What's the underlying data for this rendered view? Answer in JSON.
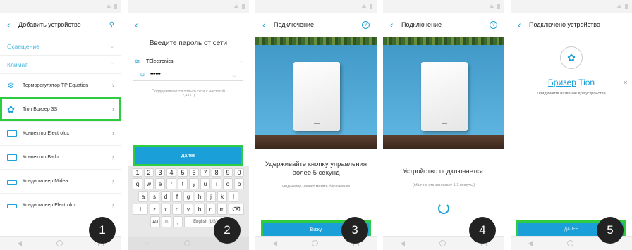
{
  "screen1": {
    "title": "Добавить устройство",
    "sections": [
      {
        "label": "Освещение"
      },
      {
        "label": "Климат"
      }
    ],
    "devices": [
      {
        "label": "Терморегулятор TP Equation",
        "icon": "snowflake-icon"
      },
      {
        "label": "Tion Бризер 3S",
        "icon": "fan-icon"
      },
      {
        "label": "Конвектор Electrolux",
        "icon": "convector-icon"
      },
      {
        "label": "Конвектор Ballu",
        "icon": "convector-icon"
      },
      {
        "label": "Кондиционер Midea",
        "icon": "ac-icon"
      },
      {
        "label": "Кондиционер Electrolux",
        "icon": "ac-icon"
      }
    ],
    "step": "1"
  },
  "screen2": {
    "title": "Введите пароль от сети",
    "network": "TElectronics",
    "password": "••••••",
    "hint": "Поддерживаются только сети с частотой 2,4 ГГц",
    "button": "Далее",
    "keys_row1": [
      "1",
      "2",
      "3",
      "4",
      "5",
      "6",
      "7",
      "8",
      "9",
      "0"
    ],
    "keys_row2": [
      "q",
      "w",
      "e",
      "r",
      "t",
      "y",
      "u",
      "i",
      "o",
      "p"
    ],
    "keys_row3": [
      "a",
      "s",
      "d",
      "f",
      "g",
      "h",
      "j",
      "k",
      "l"
    ],
    "keys_row4": [
      "z",
      "x",
      "c",
      "v",
      "b",
      "n",
      "m"
    ],
    "key_123": "123",
    "space_label": "English (US)",
    "step": "2"
  },
  "screen3": {
    "title": "Подключение",
    "message": "Удерживайте кнопку управления более 5 секунд",
    "submessage": "Индикатор начнет мигать бирюзовым",
    "button": "Вижу",
    "step": "3"
  },
  "screen4": {
    "title": "Подключение",
    "message": "Устройство подключается.",
    "submessage": "(обычно это занимает 1-3 минуты)",
    "step": "4"
  },
  "screen5": {
    "title": "Подключено устройство",
    "device_name_1": "Бризер",
    "device_name_2": "Tion",
    "hint": "Придумайте название для устройства",
    "button": "ДАЛЕЕ",
    "step": "5"
  },
  "colors": {
    "accent": "#1a9fd8",
    "highlight": "#2ecc40"
  }
}
